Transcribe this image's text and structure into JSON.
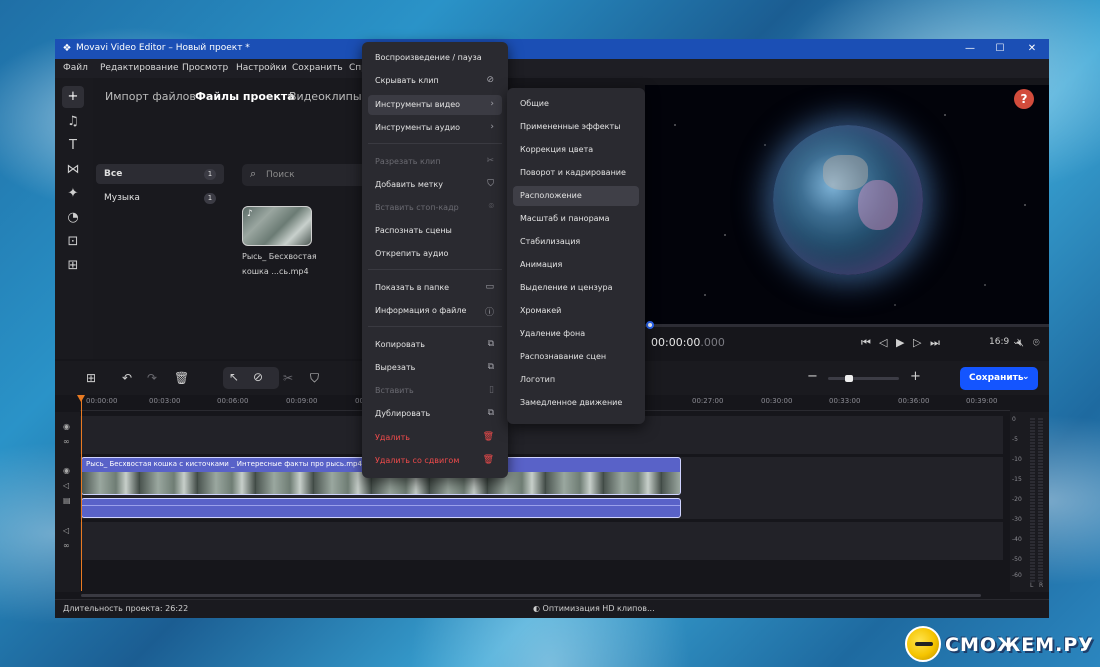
{
  "window": {
    "title": "Movavi Video Editor – Новый проект *",
    "minimize": "—",
    "maximize": "☐",
    "close": "✕"
  },
  "menubar": [
    "Файл",
    "Редактирование",
    "Просмотр",
    "Настройки",
    "Сохранить",
    "Спр"
  ],
  "import_panel": {
    "tabs": [
      "Импорт файлов",
      "Файлы проекта",
      "Видеоклипы"
    ],
    "selected_tab": "Файлы проекта",
    "categories": [
      {
        "label": "Все",
        "count": "1"
      },
      {
        "label": "Музыка",
        "count": "1"
      }
    ],
    "search_placeholder": "Поиск",
    "file": {
      "caption_line1": "Рысь_ Бесхвостая",
      "caption_line2": "кошка ...сь.mp4"
    }
  },
  "preview": {
    "help": "?",
    "timecode": "00:00:00",
    "timecode_ms": ".000",
    "aspect_ratio": "16:9"
  },
  "timeline_toolbar": {
    "save_label": "Сохранить"
  },
  "ruler_ticks": [
    "00:00:00",
    "00:03:00",
    "00:06:00",
    "00:09:00",
    "00:12:00",
    "00:27:00",
    "00:30:00",
    "00:33:00",
    "00:36:00",
    "00:39:00"
  ],
  "clip": {
    "name": "Рысь_ Бесхвостая кошка с кисточками _ Интересные факты про рысь.mp4"
  },
  "meter": {
    "labels": [
      "0",
      "-5",
      "-10",
      "-15",
      "-20",
      "-30",
      "-40",
      "-50",
      "-60"
    ],
    "channels": [
      "L",
      "R"
    ]
  },
  "statusbar": {
    "duration": "Длительность проекта: 26:22",
    "optimization": "Оптимизация HD клипов..."
  },
  "context_menu": {
    "items": [
      {
        "label": "Воспроизведение / пауза",
        "icon": "",
        "state": "normal"
      },
      {
        "label": "Скрывать клип",
        "icon": "eye-off-icon",
        "state": "normal"
      },
      {
        "label": "Инструменты видео",
        "icon": "chevron-right-icon",
        "state": "highlight"
      },
      {
        "label": "Инструменты аудио",
        "icon": "chevron-right-icon",
        "state": "normal"
      },
      {
        "label": "Разрезать клип",
        "icon": "scissors-icon",
        "state": "disabled"
      },
      {
        "label": "Добавить метку",
        "icon": "marker-icon",
        "state": "normal"
      },
      {
        "label": "Вставить стоп-кадр",
        "icon": "camera-icon",
        "state": "disabled"
      },
      {
        "label": "Распознать сцены",
        "icon": "",
        "state": "normal"
      },
      {
        "label": "Открепить аудио",
        "icon": "",
        "state": "normal"
      },
      {
        "label": "Показать в папке",
        "icon": "folder-icon",
        "state": "normal"
      },
      {
        "label": "Информация о файле",
        "icon": "info-icon",
        "state": "normal"
      },
      {
        "label": "Копировать",
        "icon": "copy-icon",
        "state": "normal"
      },
      {
        "label": "Вырезать",
        "icon": "cut-icon",
        "state": "normal"
      },
      {
        "label": "Вставить",
        "icon": "paste-icon",
        "state": "disabled"
      },
      {
        "label": "Дублировать",
        "icon": "duplicate-icon",
        "state": "normal"
      },
      {
        "label": "Удалить",
        "icon": "trash-icon",
        "state": "danger"
      },
      {
        "label": "Удалить со сдвигом",
        "icon": "trash-icon",
        "state": "danger"
      }
    ]
  },
  "submenu": {
    "items": [
      "Общие",
      "Примененные эффекты",
      "Коррекция цвета",
      "Поворот и кадрирование",
      "Расположение",
      "Масштаб и панорама",
      "Стабилизация",
      "Анимация",
      "Выделение и цензура",
      "Хромакей",
      "Удаление фона",
      "Распознавание сцен",
      "Логотип",
      "Замедленное движение"
    ],
    "highlighted": "Расположение"
  },
  "watermark": {
    "text": "СМОЖЕМ.РУ"
  },
  "colors": {
    "accent": "#1455ff",
    "titlebar": "#1b4fb5",
    "danger": "#ef4b4b",
    "playhead": "#e87a22",
    "clip": "#5962c8"
  }
}
